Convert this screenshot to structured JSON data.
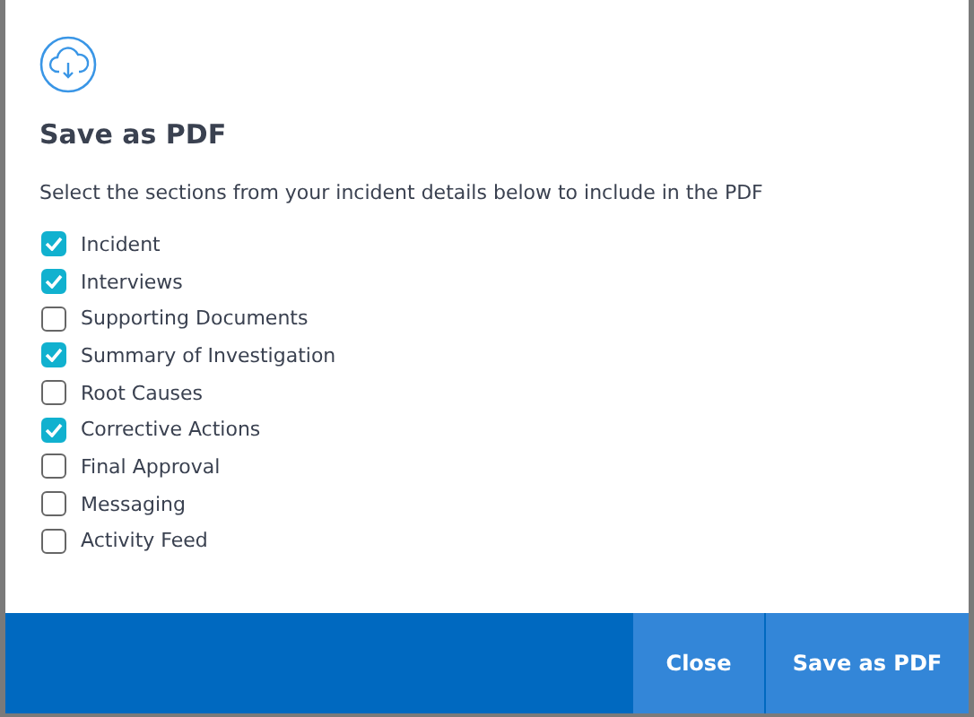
{
  "dialog": {
    "title": "Save as PDF",
    "instructions": "Select the sections from your incident details below to include in the PDF",
    "sections": [
      {
        "label": "Incident",
        "checked": true
      },
      {
        "label": "Interviews",
        "checked": true
      },
      {
        "label": "Supporting Documents",
        "checked": false
      },
      {
        "label": "Summary of Investigation",
        "checked": true
      },
      {
        "label": "Root Causes",
        "checked": false
      },
      {
        "label": "Corrective Actions",
        "checked": true
      },
      {
        "label": "Final Approval",
        "checked": false
      },
      {
        "label": "Messaging",
        "checked": false
      },
      {
        "label": "Activity Feed",
        "checked": false
      }
    ],
    "buttons": [
      "Close",
      "Save as PDF"
    ]
  }
}
